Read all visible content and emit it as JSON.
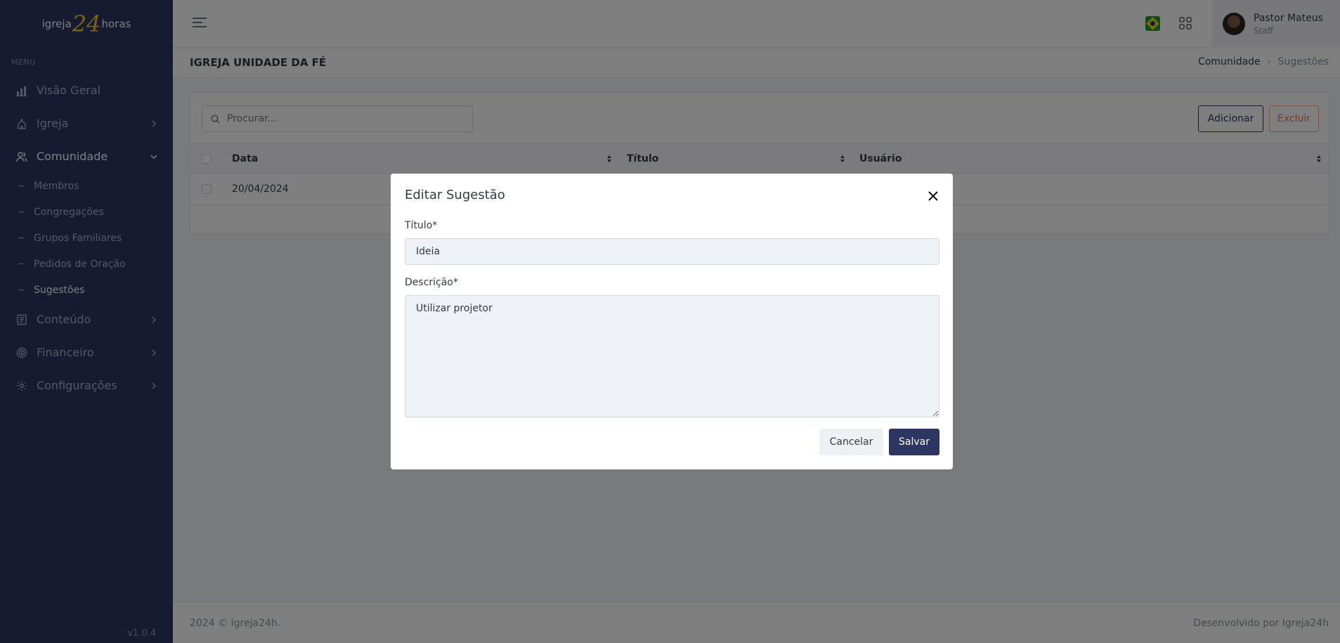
{
  "brand": {
    "logo_left": "igreja",
    "logo_number": "24",
    "logo_right": "horas",
    "version": "v1.0.4"
  },
  "sidebar": {
    "menu_title": "MENU",
    "items": [
      {
        "label": "Visão Geral",
        "icon": "chart-icon"
      },
      {
        "label": "Igreja",
        "icon": "church-icon"
      },
      {
        "label": "Comunidade",
        "icon": "users-icon"
      },
      {
        "label": "Conteúdo",
        "icon": "document-icon"
      },
      {
        "label": "Financeiro",
        "icon": "money-icon"
      },
      {
        "label": "Configurações",
        "icon": "gear-icon"
      }
    ],
    "sub_items": [
      "Membros",
      "Congregações",
      "Grupos Familiares",
      "Pedidos de Oração",
      "Sugestões"
    ]
  },
  "topbar": {
    "user_name": "Pastor Mateus",
    "user_role": "Staff"
  },
  "page": {
    "title": "IGREJA UNIDADE DA FÉ",
    "breadcrumb": [
      "Comunidade",
      "Sugestões"
    ]
  },
  "toolbar": {
    "search_placeholder": "Procurar...",
    "add_label": "Adicionar",
    "delete_label": "Excluir"
  },
  "table": {
    "columns": [
      "Data",
      "Título",
      "Usuário"
    ],
    "rows": [
      {
        "data": "20/04/2024",
        "titulo": "",
        "usuario": ""
      }
    ]
  },
  "modal": {
    "title": "Editar Sugestão",
    "titulo_label": "Título*",
    "titulo_value": "Ideia",
    "descricao_label": "Descrição*",
    "descricao_value": "Utilizar projetor",
    "cancel_label": "Cancelar",
    "save_label": "Salvar"
  },
  "footer": {
    "left": "2024 © Igreja24h.",
    "right": "Desenvolvido por Igreja24h"
  },
  "colors": {
    "sidebar_bg": "#2d3662",
    "primary": "#2d3662",
    "danger": "#ee7a50",
    "logo_accent": "#f2c61b"
  }
}
